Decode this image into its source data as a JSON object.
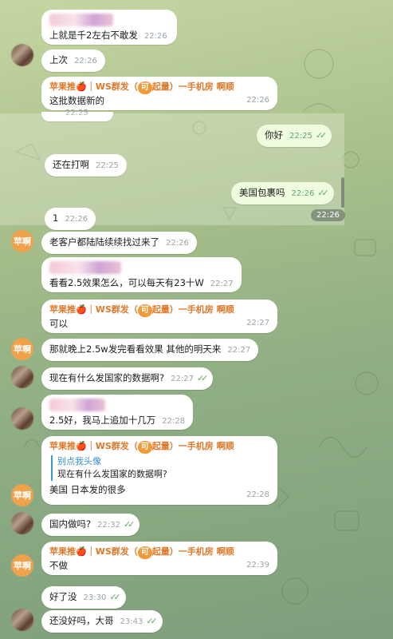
{
  "colors": {
    "incoming": "#ffffff",
    "outgoing": "#effdde",
    "sender": "#e0792a",
    "reply_name": "#3a8fd6",
    "check": "#5eab65"
  },
  "sender_name": {
    "prefix": "苹果推",
    "apple": "🍎",
    "middle": "｜WS群发（",
    "tag": "可",
    "suffix": "起量）一手机房 啊顺"
  },
  "avatar_label": "苹啊",
  "messages": [
    {
      "text": "上就是千2左右不敢发",
      "time": "22:26"
    },
    {
      "text": "上次",
      "time": "22:26"
    },
    {
      "text": "这批数据新的",
      "time": "22:26"
    },
    {
      "text": "你好",
      "time": "22:25"
    },
    {
      "text": "还在打啊",
      "time": "22:25"
    },
    {
      "text": "美国包裹吗",
      "time": "22:26"
    },
    {
      "text": "1",
      "time": "22:26"
    },
    {
      "text": "老客户都陆陆续续找过来了",
      "time": "22:26"
    },
    {
      "text": "看看2.5效果怎么，可以每天有23十W",
      "time": "22:27"
    },
    {
      "text": "可以",
      "time": "22:27"
    },
    {
      "text": "那就晚上2.5w发完看看效果 其他的明天来",
      "time": "22:27"
    },
    {
      "text": "现在有什么发国家的数据啊?",
      "time": "22:27"
    },
    {
      "text": "2.5好，我马上追加十几万",
      "time": "22:28"
    },
    {
      "text": "美国 日本发的很多",
      "time": "22:28",
      "reply_name": "别点我头像",
      "reply_text": "现在有什么发国家的数据啊?"
    },
    {
      "text": "国内做吗?",
      "time": "22:32"
    },
    {
      "text": "不做",
      "time": "22:39"
    },
    {
      "text": "好了没",
      "time": "23:30"
    },
    {
      "text": "还没好吗，大哥",
      "time": "23:43"
    }
  ],
  "floating_date": "22:26",
  "partial_time": "22:25"
}
